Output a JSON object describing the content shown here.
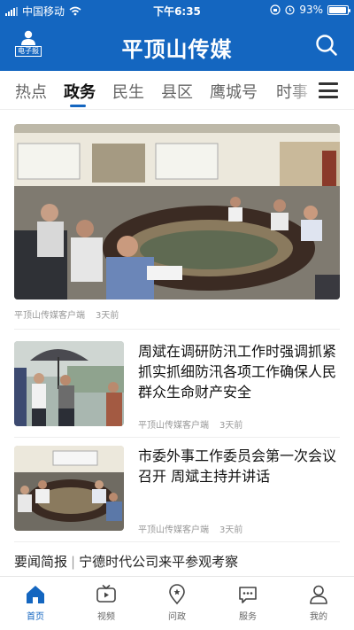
{
  "status_bar": {
    "carrier": "中国移动",
    "time": "下午6:35",
    "battery": "93%"
  },
  "header": {
    "epaper_label": "电子报",
    "brand": "平顶山传媒"
  },
  "tabs": [
    {
      "label": "热点"
    },
    {
      "label": "政务"
    },
    {
      "label": "民生"
    },
    {
      "label": "县区"
    },
    {
      "label": "鹰城号"
    },
    {
      "label": "时事"
    }
  ],
  "feed": {
    "hero": {
      "source": "平顶山传媒客户端",
      "time": "3天前"
    },
    "items": [
      {
        "title": "周斌在调研防汛工作时强调抓紧抓实抓细防汛各项工作确保人民群众生命财产安全",
        "source": "平顶山传媒客户端",
        "time": "3天前"
      },
      {
        "title": "市委外事工作委员会第一次会议召开 周斌主持并讲话",
        "source": "平顶山传媒客户端",
        "time": "3天前"
      }
    ],
    "brief": {
      "label": "要闻简报",
      "text": "宁德时代公司来平参观考察"
    }
  },
  "bottom_nav": [
    {
      "label": "首页",
      "icon": "home-icon",
      "active": true
    },
    {
      "label": "视频",
      "icon": "tv-icon",
      "active": false
    },
    {
      "label": "问政",
      "icon": "location-pin-icon",
      "active": false
    },
    {
      "label": "服务",
      "icon": "chat-icon",
      "active": false
    },
    {
      "label": "我的",
      "icon": "user-icon",
      "active": false
    }
  ],
  "colors": {
    "brand_blue": "#1466c0",
    "meta_gray": "#999999"
  }
}
